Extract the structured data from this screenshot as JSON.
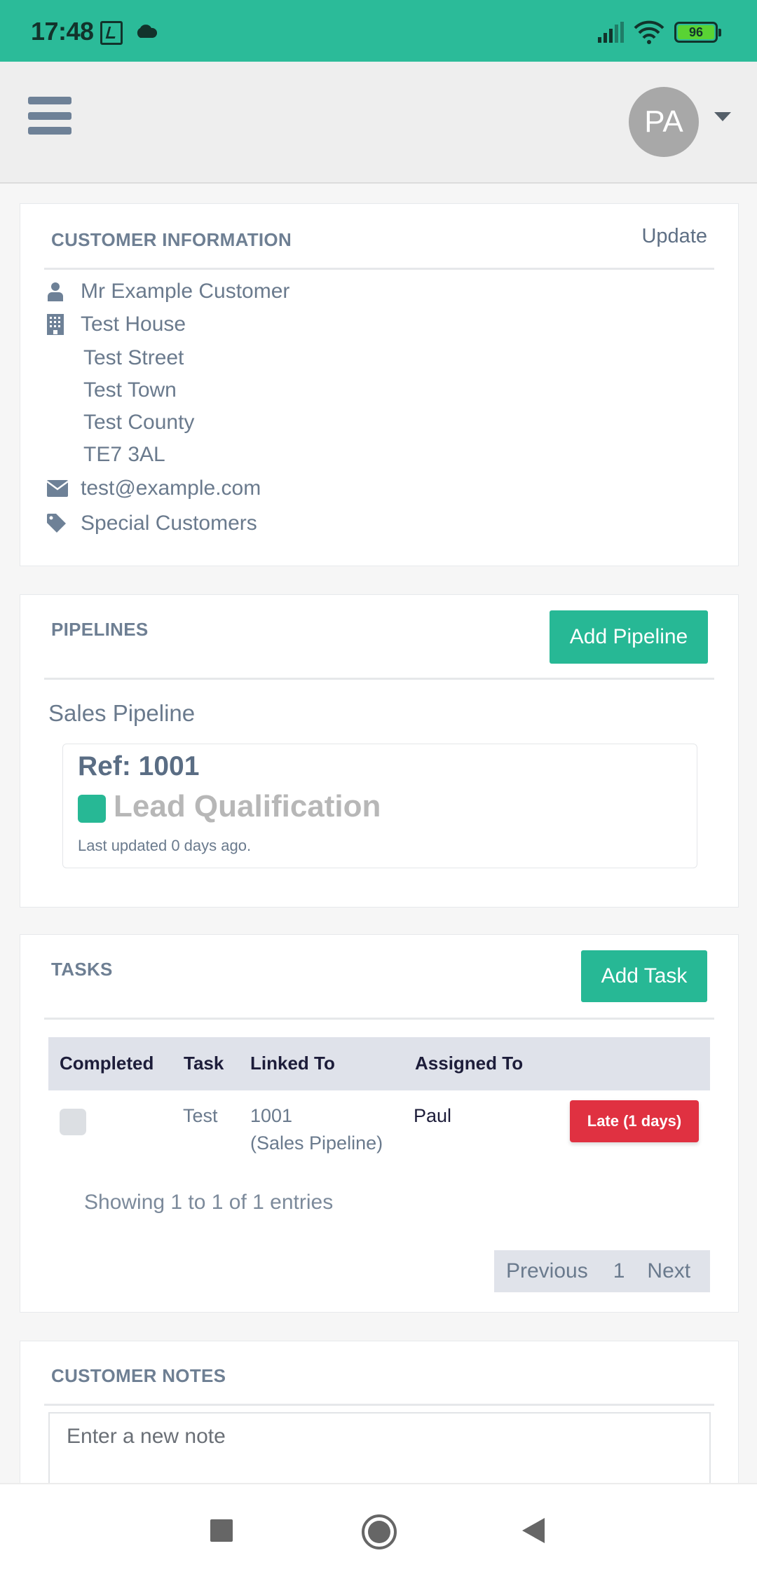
{
  "status_bar": {
    "time": "17:48",
    "battery_level": "96",
    "icons": [
      "screen-record-icon",
      "cloud-icon",
      "signal-icon",
      "wifi-icon",
      "battery-icon"
    ]
  },
  "header": {
    "menu_icon": "hamburger-icon",
    "avatar_initials": "PA",
    "dropdown_icon": "caret-down-icon"
  },
  "customer_info": {
    "title": "CUSTOMER INFORMATION",
    "update_label": "Update",
    "name": "Mr Example Customer",
    "address": [
      "Test House",
      "Test Street",
      "Test Town",
      "Test County",
      "TE7 3AL"
    ],
    "email": "test@example.com",
    "group": "Special Customers"
  },
  "pipelines": {
    "title": "PIPELINES",
    "add_label": "Add Pipeline",
    "items": [
      {
        "pipeline_name": "Sales Pipeline",
        "ref": "Ref: 1001",
        "stage": "Lead Qualification",
        "stage_color": "#27b895",
        "last_updated": "Last updated 0 days ago."
      }
    ]
  },
  "tasks": {
    "title": "TASKS",
    "add_label": "Add Task",
    "columns": [
      "Completed",
      "Task",
      "Linked To",
      "Assigned To"
    ],
    "rows": [
      {
        "completed": false,
        "task": "Test",
        "linked_ref": "1001",
        "linked_pipeline": "(Sales Pipeline)",
        "assigned_to": "Paul",
        "status": "Late (1 days)",
        "status_color": "#e03141"
      }
    ],
    "showing": "Showing 1 to 1 of 1 entries",
    "pager": {
      "previous": "Previous",
      "current": "1",
      "next": "Next"
    }
  },
  "notes": {
    "title": "CUSTOMER NOTES",
    "placeholder": "Enter a new note",
    "value": ""
  },
  "colors": {
    "brand": "#2bbb99",
    "button": "#27b895",
    "danger": "#e03141"
  }
}
